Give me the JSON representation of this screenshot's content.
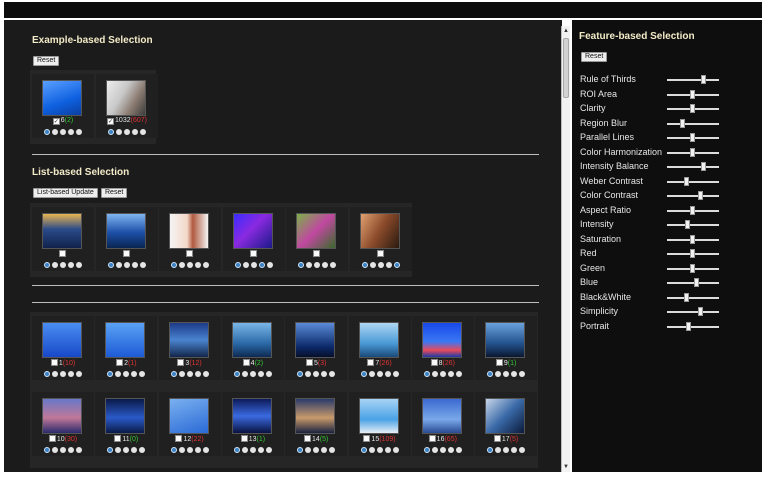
{
  "example": {
    "title": "Example-based Selection",
    "reset": "Reset",
    "items": [
      {
        "num": "6",
        "score": "(2)",
        "sign": "pos",
        "checked": true,
        "thumb": "linear-gradient(160deg,#5aa0ff 0%,#0f60e0 60%,#0a3fa0 100%)"
      },
      {
        "num": "1032",
        "score": "(607)",
        "sign": "neg",
        "checked": true,
        "thumb": "linear-gradient(120deg,#ececec 0%,#c8c8c8 40%,#8a7a70 70%,#3c3c3c 100%)"
      }
    ]
  },
  "list": {
    "title": "List-based Selection",
    "update": "List-based Update",
    "reset": "Reset",
    "items": [
      {
        "thumb": "linear-gradient(180deg,#e9b450 0%,#2a4a8a 45%,#10224a 100%)"
      },
      {
        "thumb": "linear-gradient(180deg,#7fb5f0 0%,#1c4fa8 55%,#0a2552 100%)"
      },
      {
        "thumb": "linear-gradient(90deg,#f4f4f4 0%,#f4d8c8 45%,#b05a40 60%,#f4f4f4 100%)"
      },
      {
        "thumb": "linear-gradient(135deg,#3a2cff 0%,#8a2ae0 45%,#1a1a88 100%)"
      },
      {
        "thumb": "linear-gradient(135deg,#7cb04a 0%,#c048a0 50%,#3a6a2a 100%)"
      },
      {
        "thumb": "linear-gradient(120deg,#e0a070 0%,#8a4a2a 50%,#2a1a10 100%)"
      }
    ]
  },
  "results": {
    "rows": [
      [
        {
          "num": "1",
          "score": "(10)",
          "sign": "neg",
          "thumb": "linear-gradient(180deg,#4a8ef2 0%,#1848c8 100%)"
        },
        {
          "num": "2",
          "score": "(1)",
          "sign": "neg",
          "thumb": "linear-gradient(180deg,#5aa2f5 0%,#1d5ad6 100%)"
        },
        {
          "num": "3",
          "score": "(12)",
          "sign": "neg",
          "thumb": "linear-gradient(180deg,#1c3a88 0%,#4a84d0 50%,#12264a 100%)"
        },
        {
          "num": "4",
          "score": "(2)",
          "sign": "pos",
          "thumb": "linear-gradient(180deg,#7ab6e6 0%,#2a6aa8 60%,#0e2a52 100%)"
        },
        {
          "num": "5",
          "score": "(3)",
          "sign": "neg",
          "thumb": "linear-gradient(180deg,#5a8ad8 0%,#0c2a6a 70%,#060f2a 100%)"
        },
        {
          "num": "7",
          "score": "(26)",
          "sign": "neg",
          "thumb": "linear-gradient(180deg,#aed6f4 0%,#4a9ad6 60%,#1a4a7a 100%)"
        },
        {
          "num": "8",
          "score": "(26)",
          "sign": "neg",
          "thumb": "linear-gradient(180deg,#1848e8 0%,#3a78f4 55%,#e84a5a 80%,#1a3aa8 100%)"
        },
        {
          "num": "9",
          "score": "(1)",
          "sign": "pos",
          "thumb": "linear-gradient(180deg,#6aa2dc 0%,#23528e 60%,#0a1830 100%)"
        }
      ],
      [
        {
          "num": "10",
          "score": "(30)",
          "sign": "neg",
          "thumb": "linear-gradient(180deg,#6878c8 0%,#c07898 55%,#2a2a6a 100%)"
        },
        {
          "num": "11",
          "score": "(0)",
          "sign": "pos",
          "thumb": "linear-gradient(180deg,#0a1a48 0%,#2a5ac8 55%,#0a1a48 100%)"
        },
        {
          "num": "12",
          "score": "(22)",
          "sign": "neg",
          "thumb": "linear-gradient(160deg,#7ab0f0 0%,#2a6ad6 100%)"
        },
        {
          "num": "13",
          "score": "(1)",
          "sign": "pos",
          "thumb": "linear-gradient(180deg,#0e1a5a 0%,#3a6ae0 50%,#0a1240 100%)"
        },
        {
          "num": "14",
          "score": "(5)",
          "sign": "pos",
          "thumb": "linear-gradient(180deg,#2a3a6a 0%,#c89a6a 55%,#1a2240 100%)"
        },
        {
          "num": "15",
          "score": "(109)",
          "sign": "neg",
          "thumb": "linear-gradient(180deg,#a8d4f6 0%,#4aa2e6 60%,#e8eef4 100%)"
        },
        {
          "num": "16",
          "score": "(65)",
          "sign": "neg",
          "thumb": "linear-gradient(180deg,#3a6ad0 0%,#7aa8ea 60%,#2a4a90 100%)"
        },
        {
          "num": "17",
          "score": "(5)",
          "sign": "neg",
          "thumb": "linear-gradient(135deg,#c8d6ea 0%,#3a6aa8 50%,#0a1a3a 100%)"
        }
      ]
    ]
  },
  "features": {
    "title": "Feature-based Selection",
    "reset": "Reset",
    "sliders": [
      {
        "label": "Rule of Thirds",
        "value": 0.72
      },
      {
        "label": "ROI Area",
        "value": 0.5
      },
      {
        "label": "Clarity",
        "value": 0.5
      },
      {
        "label": "Region Blur",
        "value": 0.3
      },
      {
        "label": "Parallel Lines",
        "value": 0.5
      },
      {
        "label": "Color Harmonization",
        "value": 0.5
      },
      {
        "label": "Intensity Balance",
        "value": 0.72
      },
      {
        "label": "Weber Contrast",
        "value": 0.38
      },
      {
        "label": "Color Contrast",
        "value": 0.66
      },
      {
        "label": "Aspect Ratio",
        "value": 0.5
      },
      {
        "label": "Intensity",
        "value": 0.4
      },
      {
        "label": "Saturation",
        "value": 0.5
      },
      {
        "label": "Red",
        "value": 0.5
      },
      {
        "label": "Green",
        "value": 0.5
      },
      {
        "label": "Blue",
        "value": 0.58
      },
      {
        "label": "Black&White",
        "value": 0.38
      },
      {
        "label": "Simplicity",
        "value": 0.66
      },
      {
        "label": "Portrait",
        "value": 0.42
      }
    ]
  }
}
